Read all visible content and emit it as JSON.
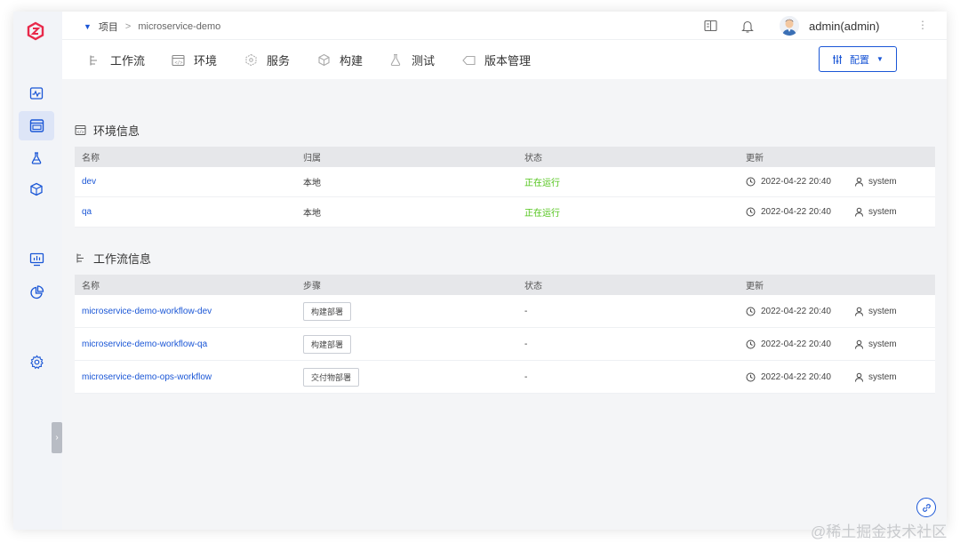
{
  "header": {
    "breadcrumb_root": "项目",
    "breadcrumb_sep": ">",
    "breadcrumb_current": "microservice-demo",
    "username": "admin(admin)"
  },
  "nav": {
    "tabs": [
      {
        "label": "工作流",
        "icon": "workflow-icon"
      },
      {
        "label": "环境",
        "icon": "environment-icon"
      },
      {
        "label": "服务",
        "icon": "service-icon"
      },
      {
        "label": "构建",
        "icon": "build-icon"
      },
      {
        "label": "测试",
        "icon": "test-icon"
      },
      {
        "label": "版本管理",
        "icon": "version-icon"
      }
    ],
    "config_label": "配置"
  },
  "env_section": {
    "title": "环境信息",
    "columns": [
      "名称",
      "归属",
      "状态",
      "更新"
    ],
    "rows": [
      {
        "name": "dev",
        "owner": "本地",
        "status": "正在运行",
        "updated": "2022-04-22 20:40",
        "user": "system"
      },
      {
        "name": "qa",
        "owner": "本地",
        "status": "正在运行",
        "updated": "2022-04-22 20:40",
        "user": "system"
      }
    ]
  },
  "workflow_section": {
    "title": "工作流信息",
    "columns": [
      "名称",
      "步骤",
      "状态",
      "更新"
    ],
    "rows": [
      {
        "name": "microservice-demo-workflow-dev",
        "step": "构建部署",
        "status": "-",
        "updated": "2022-04-22 20:40",
        "user": "system"
      },
      {
        "name": "microservice-demo-workflow-qa",
        "step": "构建部署",
        "status": "-",
        "updated": "2022-04-22 20:40",
        "user": "system"
      },
      {
        "name": "microservice-demo-ops-workflow",
        "step": "交付物部署",
        "status": "-",
        "updated": "2022-04-22 20:40",
        "user": "system"
      }
    ]
  },
  "colors": {
    "accent": "#1a56d6",
    "running": "#52c41a",
    "brand": "#e8294a"
  },
  "watermark": "@稀土掘金技术社区"
}
